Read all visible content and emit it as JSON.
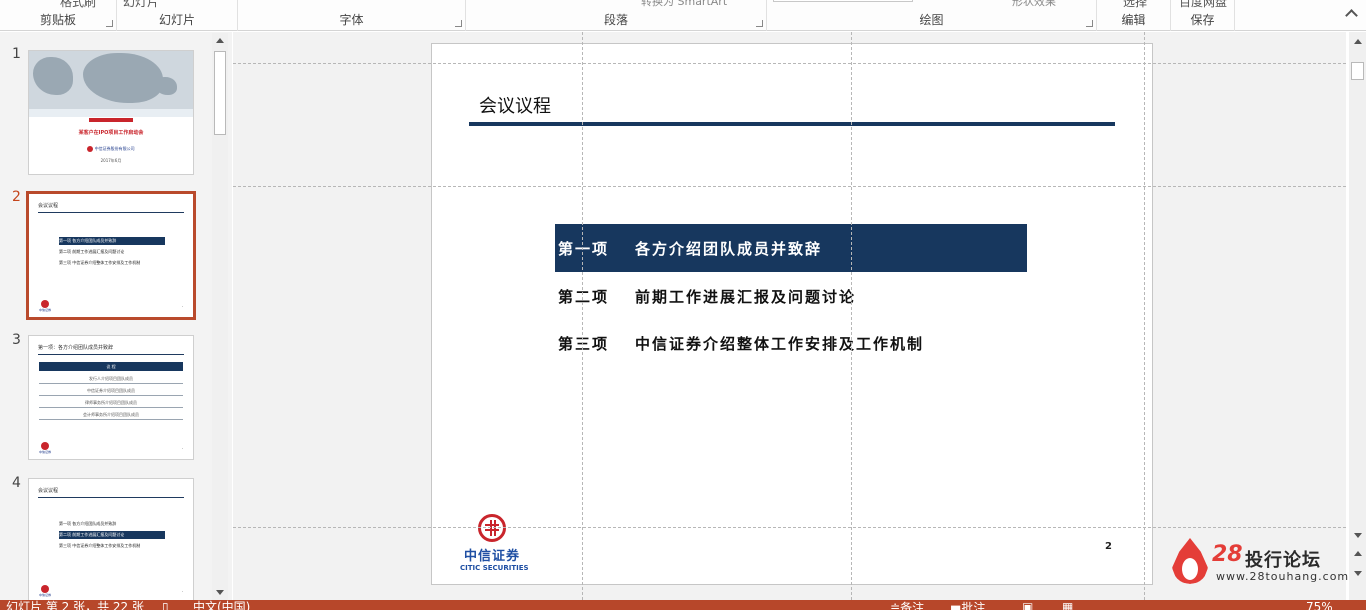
{
  "ribbon": {
    "groups": [
      {
        "label": "剪贴板",
        "cut_above": "格式刷"
      },
      {
        "label": "幻灯片",
        "cut_above": "幻灯片"
      },
      {
        "label": "字体"
      },
      {
        "label": "段落",
        "cut_above": "转换为 SmartArt"
      },
      {
        "label": "绘图",
        "cut_above": "形状效果"
      },
      {
        "label": "编辑",
        "cut_above": "选择"
      },
      {
        "label": "保存",
        "cut_above": "百度网盘"
      }
    ]
  },
  "thumbnails": [
    {
      "number": "1",
      "active": false,
      "cover_title": "某客户在IPO项目工作启动会",
      "logo": "中信证券股份有限公司",
      "date": "2017年6月"
    },
    {
      "number": "2",
      "active": true,
      "title": "会议议程",
      "rows": [
        "第一项 各方介绍团队成员并致辞",
        "第二项 前期工作进展汇报及问题讨论",
        "第三项 中信证券介绍整体工作安排及工作机制"
      ],
      "highlight": 0
    },
    {
      "number": "3",
      "active": false,
      "title": "第一项：各方介绍团队成员并致辞",
      "table_header": "议 程",
      "rows": [
        "发行人介绍项目团队成员",
        "中信证券介绍项目团队成员",
        "律师事务所介绍项目团队成员",
        "会计师事务所介绍项目团队成员"
      ]
    },
    {
      "number": "4",
      "active": false,
      "title": "会议议程",
      "rows": [
        "第一项 各方介绍团队成员并致辞",
        "第二项 前期工作进展汇报及问题讨论",
        "第三项 中信证券介绍整体工作安排及工作机制"
      ],
      "highlight": 1
    }
  ],
  "slide": {
    "title": "会议议程",
    "agenda": [
      {
        "no": "第一项",
        "text": "各方介绍团队成员并致辞",
        "highlighted": true
      },
      {
        "no": "第二项",
        "text": "前期工作进展汇报及问题讨论",
        "highlighted": false
      },
      {
        "no": "第三项",
        "text": "中信证券介绍整体工作安排及工作机制",
        "highlighted": false
      }
    ],
    "logo_cn": "中信证券",
    "logo_en": "CITIC SECURITIES",
    "page_number": "2"
  },
  "watermark": {
    "number": "28",
    "name": "投行论坛",
    "url": "www.28touhang.com"
  },
  "statusbar": {
    "slide_info": "幻灯片 第 2 张，共 22 张",
    "language": "中文(中国)",
    "notes": "备注",
    "comments": "批注",
    "zoom": "75%"
  },
  "colors": {
    "accent_navy": "#17375e",
    "brand_red": "#c9252c",
    "status_bar": "#b7472a",
    "active_thumb_border": "#b94a2c"
  }
}
